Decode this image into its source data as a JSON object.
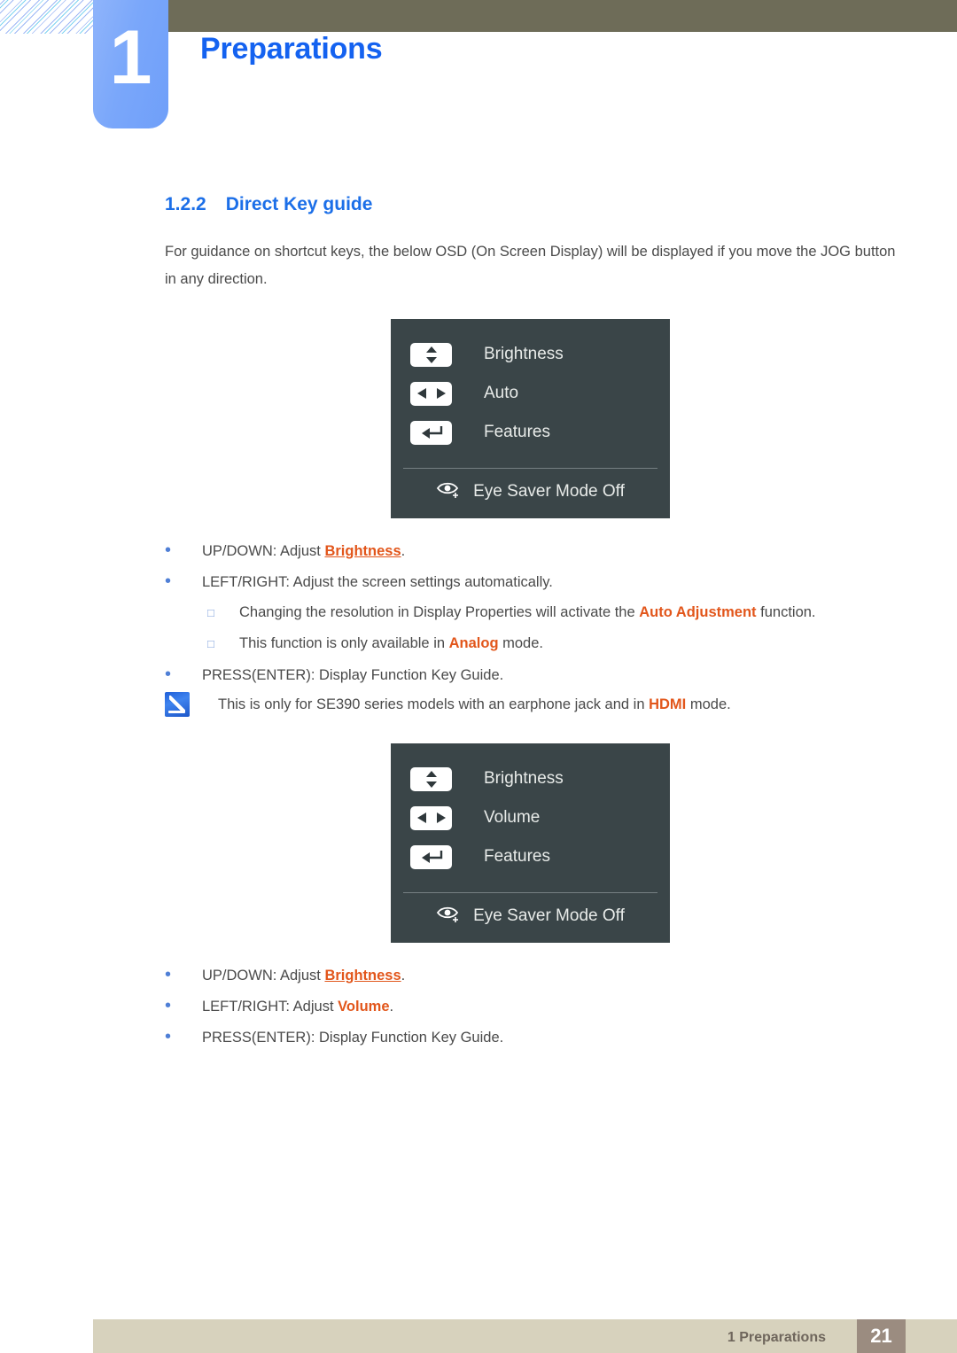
{
  "header": {
    "chapter_number": "1",
    "chapter_title": "Preparations",
    "olive_color": "#6e6c58",
    "tab_color": "#7aa7fa",
    "title_color": "#1462f0"
  },
  "section": {
    "number": "1.2.2",
    "title": "Direct Key guide",
    "color": "#1c6fe8"
  },
  "intro": "For guidance on shortcut keys, the below OSD (On Screen Display) will be displayed if you move the JOG button in any direction.",
  "osd_menus": [
    {
      "rows": [
        {
          "key_icon": "up-down-arrows-icon",
          "label": "Brightness"
        },
        {
          "key_icon": "left-right-arrows-icon",
          "label": "Auto"
        },
        {
          "key_icon": "enter-return-arrow-icon",
          "label": "Features"
        }
      ],
      "footer": {
        "icon": "eye-saver-icon",
        "label": "Eye Saver Mode Off"
      },
      "background": "#3a4548"
    },
    {
      "rows": [
        {
          "key_icon": "up-down-arrows-icon",
          "label": "Brightness"
        },
        {
          "key_icon": "left-right-arrows-icon",
          "label": "Volume"
        },
        {
          "key_icon": "enter-return-arrow-icon",
          "label": "Features"
        }
      ],
      "footer": {
        "icon": "eye-saver-icon",
        "label": "Eye Saver Mode Off"
      },
      "background": "#3a4548"
    }
  ],
  "bullets_first": [
    {
      "level": 1,
      "bullet": "•",
      "prefix": "UP/DOWN: Adjust ",
      "highlight": "Brightness",
      "highlight_style": "underline",
      "suffix": "."
    },
    {
      "level": 1,
      "bullet": "•",
      "prefix": "LEFT/RIGHT: Adjust the screen settings automatically.",
      "highlight": "",
      "highlight_style": "none",
      "suffix": ""
    },
    {
      "level": 2,
      "bullet": "□",
      "prefix": "Changing the resolution in Display Properties will activate the ",
      "highlight": "Auto Adjustment",
      "highlight_style": "bold",
      "suffix": " function."
    },
    {
      "level": 2,
      "bullet": "□",
      "prefix": "This function is only available in ",
      "highlight": "Analog",
      "highlight_style": "bold",
      "suffix": " mode."
    },
    {
      "level": 1,
      "bullet": "•",
      "prefix": "PRESS(ENTER): Display Function Key Guide.",
      "highlight": "",
      "highlight_style": "none",
      "suffix": ""
    }
  ],
  "note": {
    "icon": "note-pen-icon",
    "prefix": "This is only for SE390 series models with an earphone jack and  in ",
    "highlight": "HDMI",
    "suffix": " mode."
  },
  "bullets_second": [
    {
      "level": 1,
      "bullet": "•",
      "prefix": "UP/DOWN: Adjust ",
      "highlight": "Brightness",
      "highlight_style": "underline",
      "suffix": "."
    },
    {
      "level": 1,
      "bullet": "•",
      "prefix": "LEFT/RIGHT: Adjust ",
      "highlight": "Volume",
      "highlight_style": "bold",
      "suffix": "."
    },
    {
      "level": 1,
      "bullet": "•",
      "prefix": "PRESS(ENTER): Display Function Key Guide.",
      "highlight": "",
      "highlight_style": "none",
      "suffix": ""
    }
  ],
  "footer": {
    "label": "1 Preparations",
    "page": "21",
    "bar_color": "#d7d2bd",
    "page_box_color": "#9b8c80"
  },
  "colors": {
    "accent_orange": "#e2561b",
    "body_text": "#4a4a4a"
  }
}
